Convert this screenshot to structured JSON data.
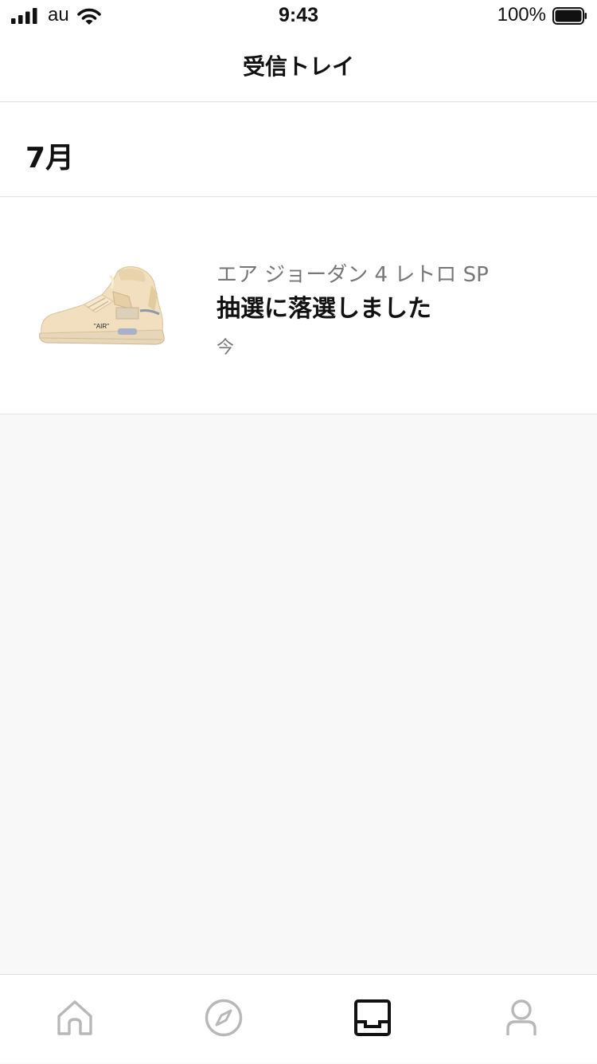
{
  "status_bar": {
    "carrier": "au",
    "time": "9:43",
    "battery": "100%",
    "battery_level": 1.0
  },
  "header": {
    "title": "受信トレイ"
  },
  "inbox": {
    "month": "7月",
    "notifications": [
      {
        "product": "エア ジョーダン 4 レトロ SP",
        "message": "抽選に落選しました",
        "time": "今"
      }
    ]
  },
  "tab_bar": {
    "active_tab": "inbox",
    "tabs": [
      {
        "icon": "home-icon"
      },
      {
        "icon": "compass-icon"
      },
      {
        "icon": "inbox-icon"
      },
      {
        "icon": "profile-icon"
      }
    ]
  },
  "colors": {
    "active_icon": "#111111",
    "inactive_icon": "#b8b8b8",
    "secondary_text": "#777777"
  }
}
